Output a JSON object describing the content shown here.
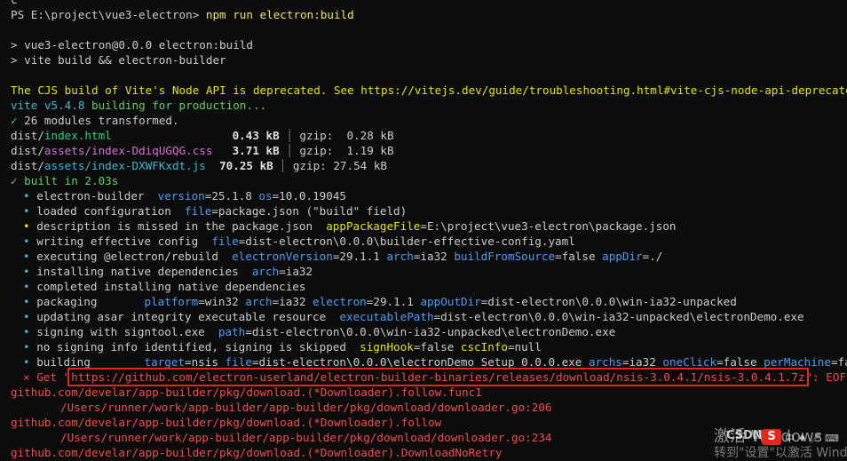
{
  "terminal": {
    "top_partial": "c",
    "prompt": "PS E:\\project\\vue3-electron> ",
    "command": "npm run electron:build",
    "script_line1": "> vue3-electron@0.0.0 electron:build",
    "script_line2": "> vite build && electron-builder",
    "cjs_warning": "The CJS build of Vite's Node API is deprecated. See https://vitejs.dev/guide/troubleshooting.html#vite-cjs-node-api-deprecated for more",
    "vite_version": "vite v5.4.8",
    "vite_building": " building for production...",
    "check_mark": "✓",
    "modules_transformed": " 26 modules transformed.",
    "files": [
      {
        "dir": "dist/",
        "name": "index.html",
        "pad": "                 ",
        "size": "0.43 kB",
        "gzip": "gzip:  0.28 kB",
        "color": "green"
      },
      {
        "dir": "dist/",
        "name": "assets/index-DdiqUGQG.css",
        "pad": "  ",
        "size": "3.71 kB",
        "gzip": "gzip:  1.19 kB",
        "color": "magenta"
      },
      {
        "dir": "dist/",
        "name": "assets/index-DXWFKxdt.js",
        "pad": "  ",
        "size": "70.25 kB",
        "gzip": "gzip: 27.54 kB",
        "color": "cyan"
      }
    ],
    "built_in": " built in 2.03s",
    "builder_lines": [
      {
        "bullet": "•",
        "bullet_color": "cyan",
        "parts": [
          {
            "t": "electron-builder  ",
            "c": "plain"
          },
          {
            "t": "version",
            "c": "blue"
          },
          {
            "t": "=25.1.8 ",
            "c": "plain"
          },
          {
            "t": "os",
            "c": "blue"
          },
          {
            "t": "=10.0.19045",
            "c": "plain"
          }
        ]
      },
      {
        "bullet": "•",
        "bullet_color": "cyan",
        "parts": [
          {
            "t": "loaded configuration  ",
            "c": "plain"
          },
          {
            "t": "file",
            "c": "blue"
          },
          {
            "t": "=package.json (\"build\" field)",
            "c": "plain"
          }
        ]
      },
      {
        "bullet": "•",
        "bullet_color": "yellow",
        "parts": [
          {
            "t": "description is missed in the package.json  ",
            "c": "plain"
          },
          {
            "t": "appPackageFile",
            "c": "yellow"
          },
          {
            "t": "=E:\\project\\vue3-electron\\package.json",
            "c": "plain"
          }
        ]
      },
      {
        "bullet": "•",
        "bullet_color": "cyan",
        "parts": [
          {
            "t": "writing effective config  ",
            "c": "plain"
          },
          {
            "t": "file",
            "c": "blue"
          },
          {
            "t": "=dist-electron\\0.0.0\\builder-effective-config.yaml",
            "c": "plain"
          }
        ]
      },
      {
        "bullet": "•",
        "bullet_color": "cyan",
        "parts": [
          {
            "t": "executing @electron/rebuild  ",
            "c": "plain"
          },
          {
            "t": "electronVersion",
            "c": "blue"
          },
          {
            "t": "=29.1.1 ",
            "c": "plain"
          },
          {
            "t": "arch",
            "c": "blue"
          },
          {
            "t": "=ia32 ",
            "c": "plain"
          },
          {
            "t": "buildFromSource",
            "c": "blue"
          },
          {
            "t": "=false ",
            "c": "plain"
          },
          {
            "t": "appDir",
            "c": "blue"
          },
          {
            "t": "=./",
            "c": "plain"
          }
        ]
      },
      {
        "bullet": "•",
        "bullet_color": "cyan",
        "parts": [
          {
            "t": "installing native dependencies  ",
            "c": "plain"
          },
          {
            "t": "arch",
            "c": "blue"
          },
          {
            "t": "=ia32",
            "c": "plain"
          }
        ]
      },
      {
        "bullet": "•",
        "bullet_color": "cyan",
        "parts": [
          {
            "t": "completed installing native dependencies",
            "c": "plain"
          }
        ]
      },
      {
        "bullet": "•",
        "bullet_color": "cyan",
        "parts": [
          {
            "t": "packaging       ",
            "c": "plain"
          },
          {
            "t": "platform",
            "c": "blue"
          },
          {
            "t": "=win32 ",
            "c": "plain"
          },
          {
            "t": "arch",
            "c": "blue"
          },
          {
            "t": "=ia32 ",
            "c": "plain"
          },
          {
            "t": "electron",
            "c": "blue"
          },
          {
            "t": "=29.1.1 ",
            "c": "plain"
          },
          {
            "t": "appOutDir",
            "c": "blue"
          },
          {
            "t": "=dist-electron\\0.0.0\\win-ia32-unpacked",
            "c": "plain"
          }
        ]
      },
      {
        "bullet": "•",
        "bullet_color": "cyan",
        "parts": [
          {
            "t": "updating asar integrity executable resource  ",
            "c": "plain"
          },
          {
            "t": "executablePath",
            "c": "blue"
          },
          {
            "t": "=dist-electron\\0.0.0\\win-ia32-unpacked\\electronDemo.exe",
            "c": "plain"
          }
        ]
      },
      {
        "bullet": "•",
        "bullet_color": "cyan",
        "parts": [
          {
            "t": "signing with signtool.exe  ",
            "c": "plain"
          },
          {
            "t": "path",
            "c": "blue"
          },
          {
            "t": "=dist-electron\\0.0.0\\win-ia32-unpacked\\electronDemo.exe",
            "c": "plain"
          }
        ]
      },
      {
        "bullet": "•",
        "bullet_color": "cyan",
        "parts": [
          {
            "t": "no signing info identified, signing is skipped  ",
            "c": "plain"
          },
          {
            "t": "signHook",
            "c": "yellow"
          },
          {
            "t": "=false ",
            "c": "plain"
          },
          {
            "t": "cscInfo",
            "c": "yellow"
          },
          {
            "t": "=null",
            "c": "plain"
          }
        ]
      },
      {
        "bullet": "•",
        "bullet_color": "cyan",
        "parts": [
          {
            "t": "building        ",
            "c": "plain"
          },
          {
            "t": "target",
            "c": "blue"
          },
          {
            "t": "=nsis ",
            "c": "plain"
          },
          {
            "t": "file",
            "c": "blue"
          },
          {
            "t": "=dist-electron\\0.0.0\\electronDemo Setup 0.0.0.exe ",
            "c": "plain"
          },
          {
            "t": "archs",
            "c": "blue"
          },
          {
            "t": "=ia32 ",
            "c": "plain"
          },
          {
            "t": "oneClick",
            "c": "blue"
          },
          {
            "t": "=false ",
            "c": "plain"
          },
          {
            "t": "perMachine",
            "c": "blue"
          },
          {
            "t": "=false",
            "c": "plain"
          }
        ]
      }
    ],
    "error": {
      "bullet": "⨯",
      "prefix": "Get \"",
      "url": "https://github.com/electron-userland/electron-builder-binaries/releases/download/nsis-3.0.4.1/nsis-3.0.4.1.7z",
      "suffix": "\": EOF"
    },
    "stack": [
      {
        "text": "github.com/develar/app-builder/pkg/download.(*Downloader).follow.func1",
        "indent": false
      },
      {
        "text": "/Users/runner/work/app-builder/app-builder/pkg/download/downloader.go:206",
        "indent": true
      },
      {
        "text": "github.com/develar/app-builder/pkg/download.(*Downloader).follow",
        "indent": false
      },
      {
        "text": "/Users/runner/work/app-builder/app-builder/pkg/download/downloader.go:234",
        "indent": true
      },
      {
        "text": "github.com/develar/app-builder/pkg/download.(*Downloader).DownloadNoRetry",
        "indent": false
      }
    ]
  },
  "watermark": {
    "line1": "激活 Windows",
    "line2": "转到\"设置\"以激活 Windows。",
    "csdn": "CSDN",
    "logo": "S",
    "icons": "中 ♦ 🎤 ⌨"
  }
}
